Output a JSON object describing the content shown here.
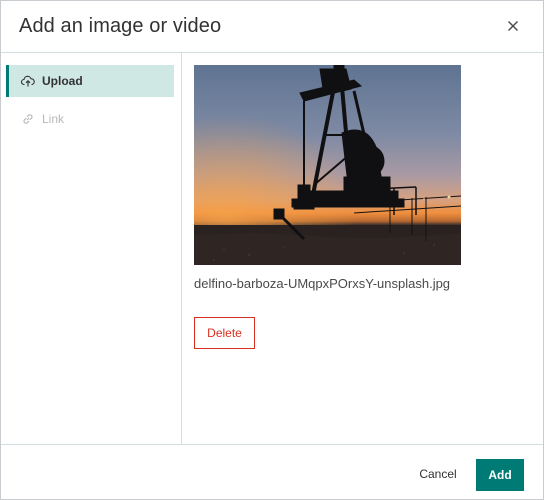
{
  "dialog": {
    "title": "Add an image or video",
    "close_icon": "close-icon"
  },
  "sidebar": {
    "items": [
      {
        "label": "Upload",
        "icon": "cloud-upload-icon",
        "state": "active"
      },
      {
        "label": "Link",
        "icon": "link-icon",
        "state": "disabled"
      }
    ]
  },
  "media": {
    "filename": "delfino-barboza-UMqpxPOrxsY-unsplash.jpg",
    "delete_label": "Delete"
  },
  "footer": {
    "cancel_label": "Cancel",
    "add_label": "Add"
  },
  "colors": {
    "accent": "#007a75",
    "active_nav_bg": "#cfe8e4",
    "danger": "#d83020"
  }
}
